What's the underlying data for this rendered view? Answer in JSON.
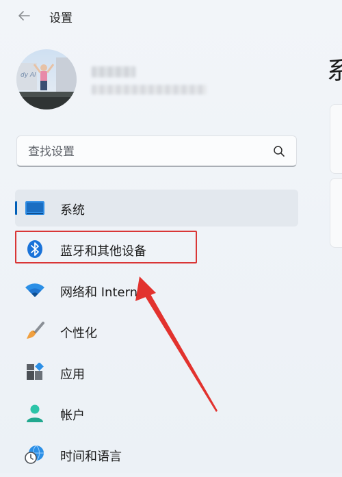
{
  "window": {
    "title": "设置"
  },
  "search": {
    "placeholder": "查找设置"
  },
  "nav": {
    "items": [
      {
        "label": "系统",
        "icon": "system-monitor-icon",
        "selected": true
      },
      {
        "label": "蓝牙和其他设备",
        "icon": "bluetooth-icon",
        "selected": false
      },
      {
        "label": "网络和 Internet",
        "icon": "wifi-icon",
        "selected": false
      },
      {
        "label": "个性化",
        "icon": "paintbrush-icon",
        "selected": false
      },
      {
        "label": "应用",
        "icon": "apps-icon",
        "selected": false
      },
      {
        "label": "帐户",
        "icon": "account-icon",
        "selected": false
      },
      {
        "label": "时间和语言",
        "icon": "time-language-icon",
        "selected": false
      }
    ]
  },
  "main": {
    "page_title_partial": "系"
  },
  "colors": {
    "accent": "#005fb8",
    "annotation_red": "#d93636",
    "background": "#eef2f7"
  }
}
